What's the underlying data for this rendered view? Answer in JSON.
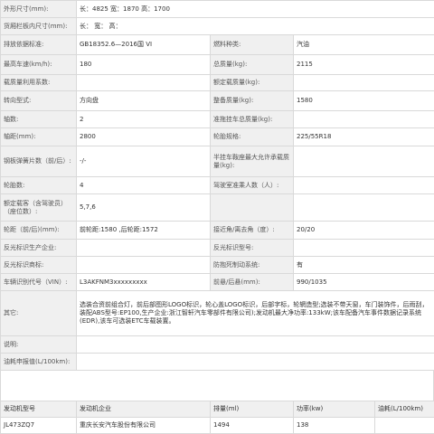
{
  "spec_rows": [
    {
      "type": "span",
      "label": "外形尺寸(mm):",
      "value": "长：4825 宽：1870 高：1700",
      "h": 19
    },
    {
      "type": "span",
      "label": "货厢栏板内尺寸(mm):",
      "value": "长：  宽：  高：",
      "h": 19
    },
    {
      "type": "pair",
      "label": "排放依据标准:",
      "value": "GB18352.6—2016国 VI",
      "label2": "燃料种类:",
      "value2": "汽油",
      "h": 22
    },
    {
      "type": "pair",
      "label": "最高车速(km/h):",
      "value": "180",
      "label2": "总质量(kg):",
      "value2": "2115",
      "h": 22
    },
    {
      "type": "pair",
      "label": "载质量利用系数:",
      "value": "",
      "label2": "额定载质量(kg):",
      "value2": "",
      "h": 18
    },
    {
      "type": "pair",
      "label": "转向型式:",
      "value": "方向盘",
      "label2": "整备质量(kg):",
      "value2": "1580",
      "h": 22
    },
    {
      "type": "pair",
      "label": "轴数:",
      "value": "2",
      "label2": "准拖挂车总质量(kg):",
      "value2": "",
      "h": 19
    },
    {
      "type": "pair",
      "label": "轴距(mm):",
      "value": "2800",
      "label2": "轮胎规格:",
      "value2": "225/55R18",
      "h": 20
    },
    {
      "type": "pair",
      "label": "钢板弹簧片数（前/后）:",
      "value": "-/-",
      "label2": "半挂车鞍座最大允许承载质量(kg):",
      "value2": "",
      "h": 34
    },
    {
      "type": "pair",
      "label": "轮胎数:",
      "value": "4",
      "label2": "驾驶室准乘人数（人）:",
      "value2": "",
      "h": 19
    },
    {
      "type": "pair",
      "label": "额定载客（含驾驶员）（座位数）:",
      "value": "5,7,6",
      "label2": "",
      "value2": "",
      "h": 30
    },
    {
      "type": "pair",
      "label": "轮距（前/后)(mm):",
      "value": "前轮距:1580 ,后轮距:1572",
      "label2": "接近角/离去角（度）:",
      "value2": "20/20",
      "h": 20
    },
    {
      "type": "pair",
      "label": "反光标识生产企业:",
      "value": "",
      "label2": "反光标识型号:",
      "value2": "",
      "h": 19
    },
    {
      "type": "pair",
      "label": "反光标识商标:",
      "value": "",
      "label2": "防抱死制动系统:",
      "value2": "有",
      "h": 19
    },
    {
      "type": "pair",
      "label": "车辆识别代号（VIN）:",
      "value": "L3AKFNM3xxxxxxxxx",
      "label2": "前悬/后悬(mm):",
      "value2": "990/1035",
      "h": 19
    },
    {
      "type": "span",
      "label": "其它:",
      "value": "选装合资前组合灯，前后部图形LOGO标识，轮心盖LOGO标识，后部字标，轮辋造型;选装不带天窗，车门装饰件，后雨刮，装配ABS型号:EP100,生产企业:浙江智轩汽车零部件有限公司);发动机最大净功率:133kW;该车配备汽车事件数据记录系统(EDR),该车可选装ETC车载装置。",
      "h": 50
    },
    {
      "type": "span",
      "label": "说明:",
      "value": "",
      "h": 19
    },
    {
      "type": "span",
      "label": "油耗申报值(L/100km):",
      "value": "",
      "h": 19
    }
  ],
  "engine_table": {
    "headers": [
      "发动机型号",
      "发动机企业",
      "排量(ml)",
      "功率(kw)",
      "油耗(L/100km)"
    ],
    "rows": [
      [
        "JL473ZQ7",
        "重庆长安汽车股份有限公司",
        "1494",
        "138",
        ""
      ]
    ]
  }
}
